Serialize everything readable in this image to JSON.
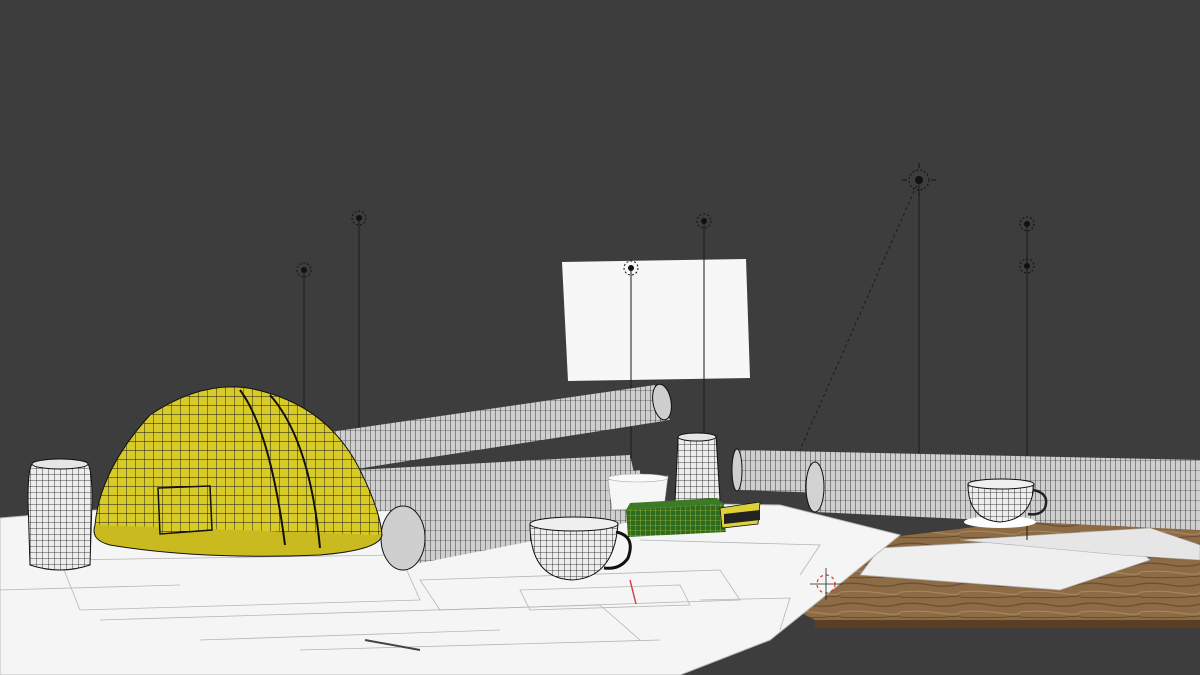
{
  "viewport": {
    "background_color": "#3d3d3d",
    "mode": "wireframe"
  },
  "colors": {
    "hard_hat": "#d9cc2a",
    "wire": "#111111",
    "paper": "#f4f4f4",
    "desk_wood": "#8a6a45",
    "box_green": "#2f6b1f",
    "tape_yellow": "#e0d23a",
    "light_helper": "#111111",
    "cursor_red": "#d83a3a"
  },
  "scene": {
    "objects": [
      {
        "name": "hard-hat",
        "icon": "hard-hat-wireframe"
      },
      {
        "name": "rolled-blueprints",
        "count": 5
      },
      {
        "name": "pencil-holder-cylinders",
        "count": 2
      },
      {
        "name": "coffee-mugs",
        "count": 3
      },
      {
        "name": "green-box",
        "icon": "box-wireframe"
      },
      {
        "name": "tape-measure",
        "icon": "tape-measure"
      },
      {
        "name": "reference-card",
        "icon": "white-plane"
      },
      {
        "name": "blueprint-sheets",
        "icon": "paper-sheets"
      },
      {
        "name": "wooden-desk",
        "icon": "desk-surface"
      }
    ],
    "light_helpers": 8,
    "cursor": "3d-cursor-icon"
  }
}
